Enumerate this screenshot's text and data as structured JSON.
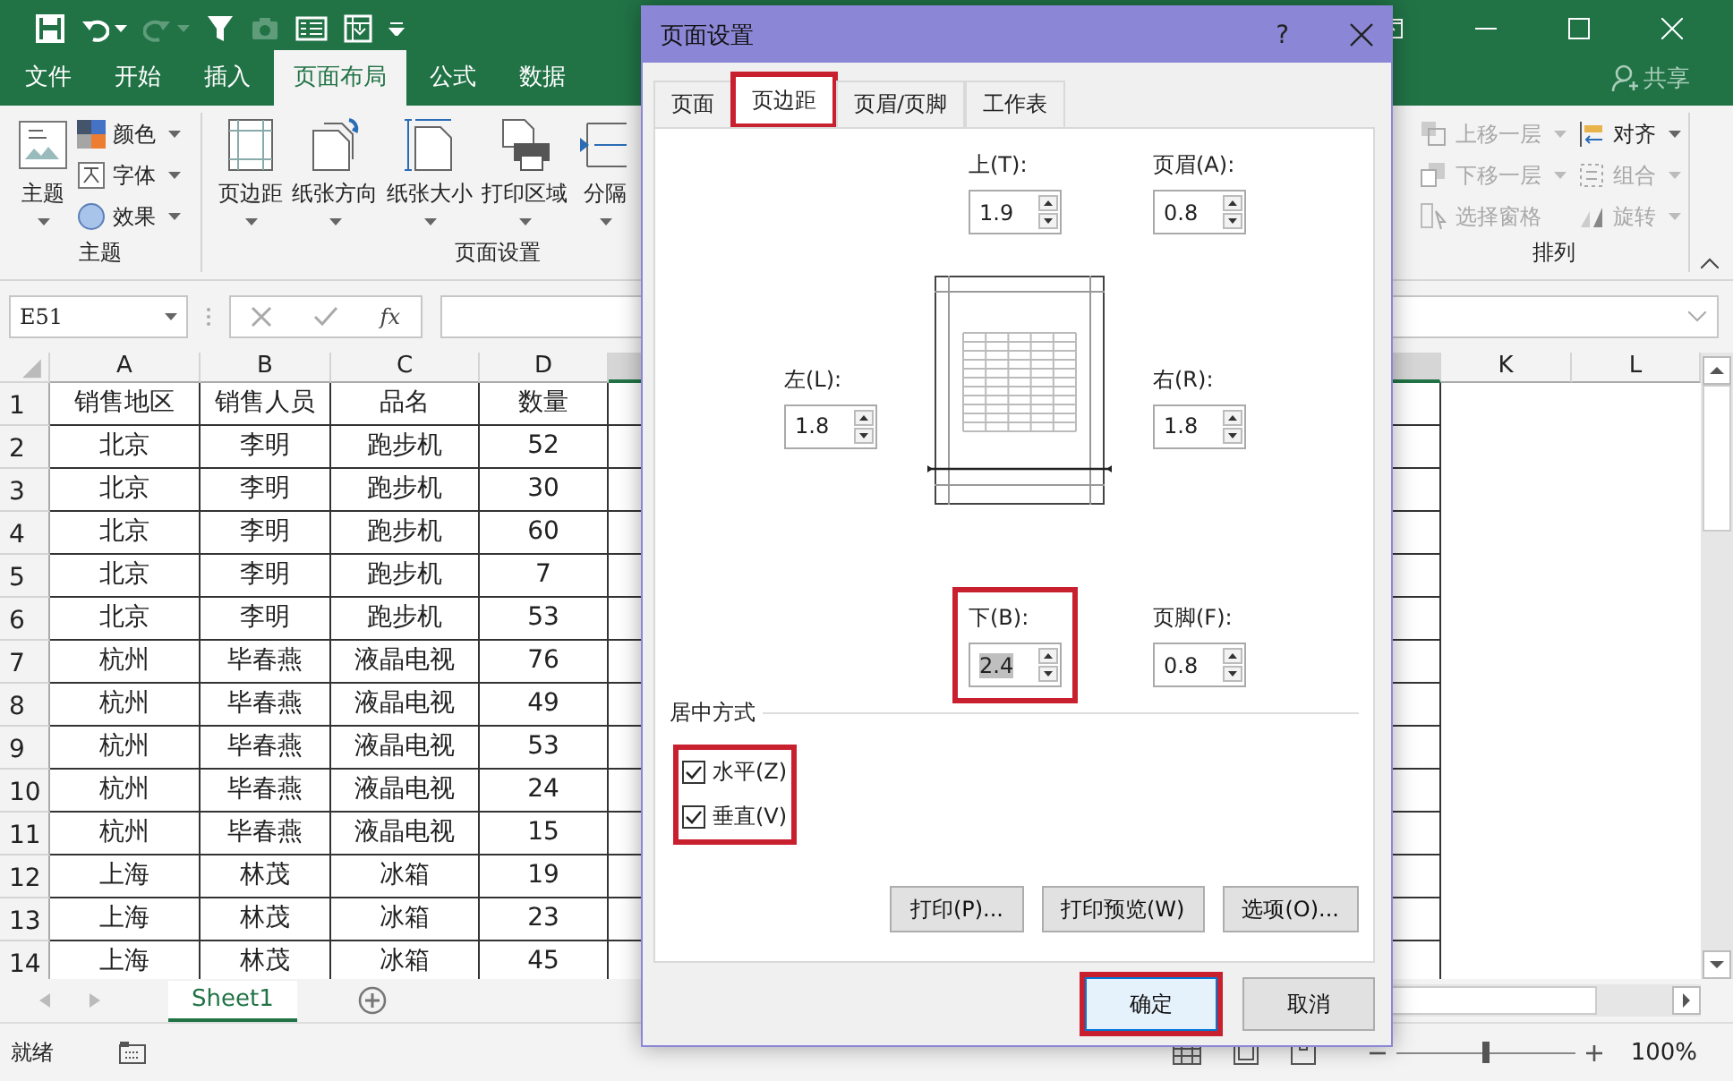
{
  "ribbon_tabs": [
    {
      "label": "文件",
      "selected": false
    },
    {
      "label": "开始",
      "selected": false
    },
    {
      "label": "插入",
      "selected": false
    },
    {
      "label": "页面布局",
      "selected": true
    },
    {
      "label": "公式",
      "selected": false
    },
    {
      "label": "数据",
      "selected": false
    }
  ],
  "share": "共享",
  "ribbon_groups": [
    {
      "kind": "theme",
      "title": "主题",
      "large": [
        "主题"
      ],
      "small": [
        {
          "label": "颜色",
          "disabled": false
        },
        {
          "label": "字体",
          "disabled": false
        },
        {
          "label": "效果",
          "disabled": false
        }
      ]
    },
    {
      "kind": "page",
      "title": "页面设置",
      "large": [
        "页边距",
        "纸张方向",
        "纸张大小",
        "打印区域",
        "分隔"
      ]
    },
    {
      "kind": "arrange",
      "title": "排列",
      "small": [
        {
          "label": "上移一层",
          "disabled": true
        },
        {
          "label": "下移一层",
          "disabled": true
        },
        {
          "label": "选择窗格",
          "disabled": true
        },
        {
          "label": "对齐",
          "disabled": false
        },
        {
          "label": "组合",
          "disabled": true
        },
        {
          "label": "旋转",
          "disabled": true
        }
      ]
    }
  ],
  "name_box": "E51",
  "fx_label": "fx",
  "sheet": {
    "columns": [
      "A",
      "B",
      "C",
      "D",
      "K",
      "L"
    ],
    "rows": [
      {
        "number": "1",
        "cells": [
          "销售地区",
          "销售人员",
          "品名",
          "数量"
        ]
      },
      {
        "number": "2",
        "cells": [
          "北京",
          "李明",
          "跑步机",
          "52"
        ]
      },
      {
        "number": "3",
        "cells": [
          "北京",
          "李明",
          "跑步机",
          "30"
        ]
      },
      {
        "number": "4",
        "cells": [
          "北京",
          "李明",
          "跑步机",
          "60"
        ]
      },
      {
        "number": "5",
        "cells": [
          "北京",
          "李明",
          "跑步机",
          "7"
        ]
      },
      {
        "number": "6",
        "cells": [
          "北京",
          "李明",
          "跑步机",
          "53"
        ]
      },
      {
        "number": "7",
        "cells": [
          "杭州",
          "毕春燕",
          "液晶电视",
          "76"
        ]
      },
      {
        "number": "8",
        "cells": [
          "杭州",
          "毕春燕",
          "液晶电视",
          "49"
        ]
      },
      {
        "number": "9",
        "cells": [
          "杭州",
          "毕春燕",
          "液晶电视",
          "53"
        ]
      },
      {
        "number": "10",
        "cells": [
          "杭州",
          "毕春燕",
          "液晶电视",
          "24"
        ]
      },
      {
        "number": "11",
        "cells": [
          "杭州",
          "毕春燕",
          "液晶电视",
          "15"
        ]
      },
      {
        "number": "12",
        "cells": [
          "上海",
          "林茂",
          "冰箱",
          "19"
        ]
      },
      {
        "number": "13",
        "cells": [
          "上海",
          "林茂",
          "冰箱",
          "23"
        ]
      },
      {
        "number": "14",
        "cells": [
          "上海",
          "林茂",
          "冰箱",
          "45"
        ]
      }
    ]
  },
  "sheet_tabs": [
    {
      "label": "Sheet1",
      "selected": true
    }
  ],
  "status_bar": {
    "status": "就绪",
    "zoom": "100%",
    "zoom_slider": {
      "level": 0.5
    }
  },
  "dialog": {
    "title": "页面设置",
    "help": "?",
    "tabs": [
      {
        "label": "页面",
        "selected": false,
        "highlighted": false
      },
      {
        "label": "页边距",
        "selected": true,
        "highlighted": true
      },
      {
        "label": "页眉/页脚",
        "selected": false,
        "highlighted": false
      },
      {
        "label": "工作表",
        "selected": false,
        "highlighted": false
      }
    ],
    "fields": [
      {
        "kind": "top",
        "label": "上(T):",
        "value": "1.9",
        "value_selected": false,
        "highlighted": false
      },
      {
        "kind": "header",
        "label": "页眉(A):",
        "value": "0.8",
        "value_selected": false,
        "highlighted": false
      },
      {
        "kind": "left",
        "label": "左(L):",
        "value": "1.8",
        "value_selected": false,
        "highlighted": false
      },
      {
        "kind": "right",
        "label": "右(R):",
        "value": "1.8",
        "value_selected": false,
        "highlighted": false
      },
      {
        "kind": "bottom",
        "label": "下(B):",
        "value": "2.4",
        "value_selected": true,
        "highlighted": true
      },
      {
        "kind": "footer",
        "label": "页脚(F):",
        "value": "0.8",
        "value_selected": false,
        "highlighted": false
      }
    ],
    "centering": {
      "title": "居中方式",
      "highlighted": true,
      "options": [
        {
          "label": "水平(Z)",
          "checked": true
        },
        {
          "label": "垂直(V)",
          "checked": true
        }
      ]
    },
    "action_buttons": [
      "打印(P)...",
      "打印预览(W)",
      "选项(O)..."
    ],
    "buttons": [
      {
        "label": "确定",
        "default": true,
        "highlighted": true
      },
      {
        "label": "取消",
        "default": false,
        "highlighted": false
      }
    ]
  }
}
